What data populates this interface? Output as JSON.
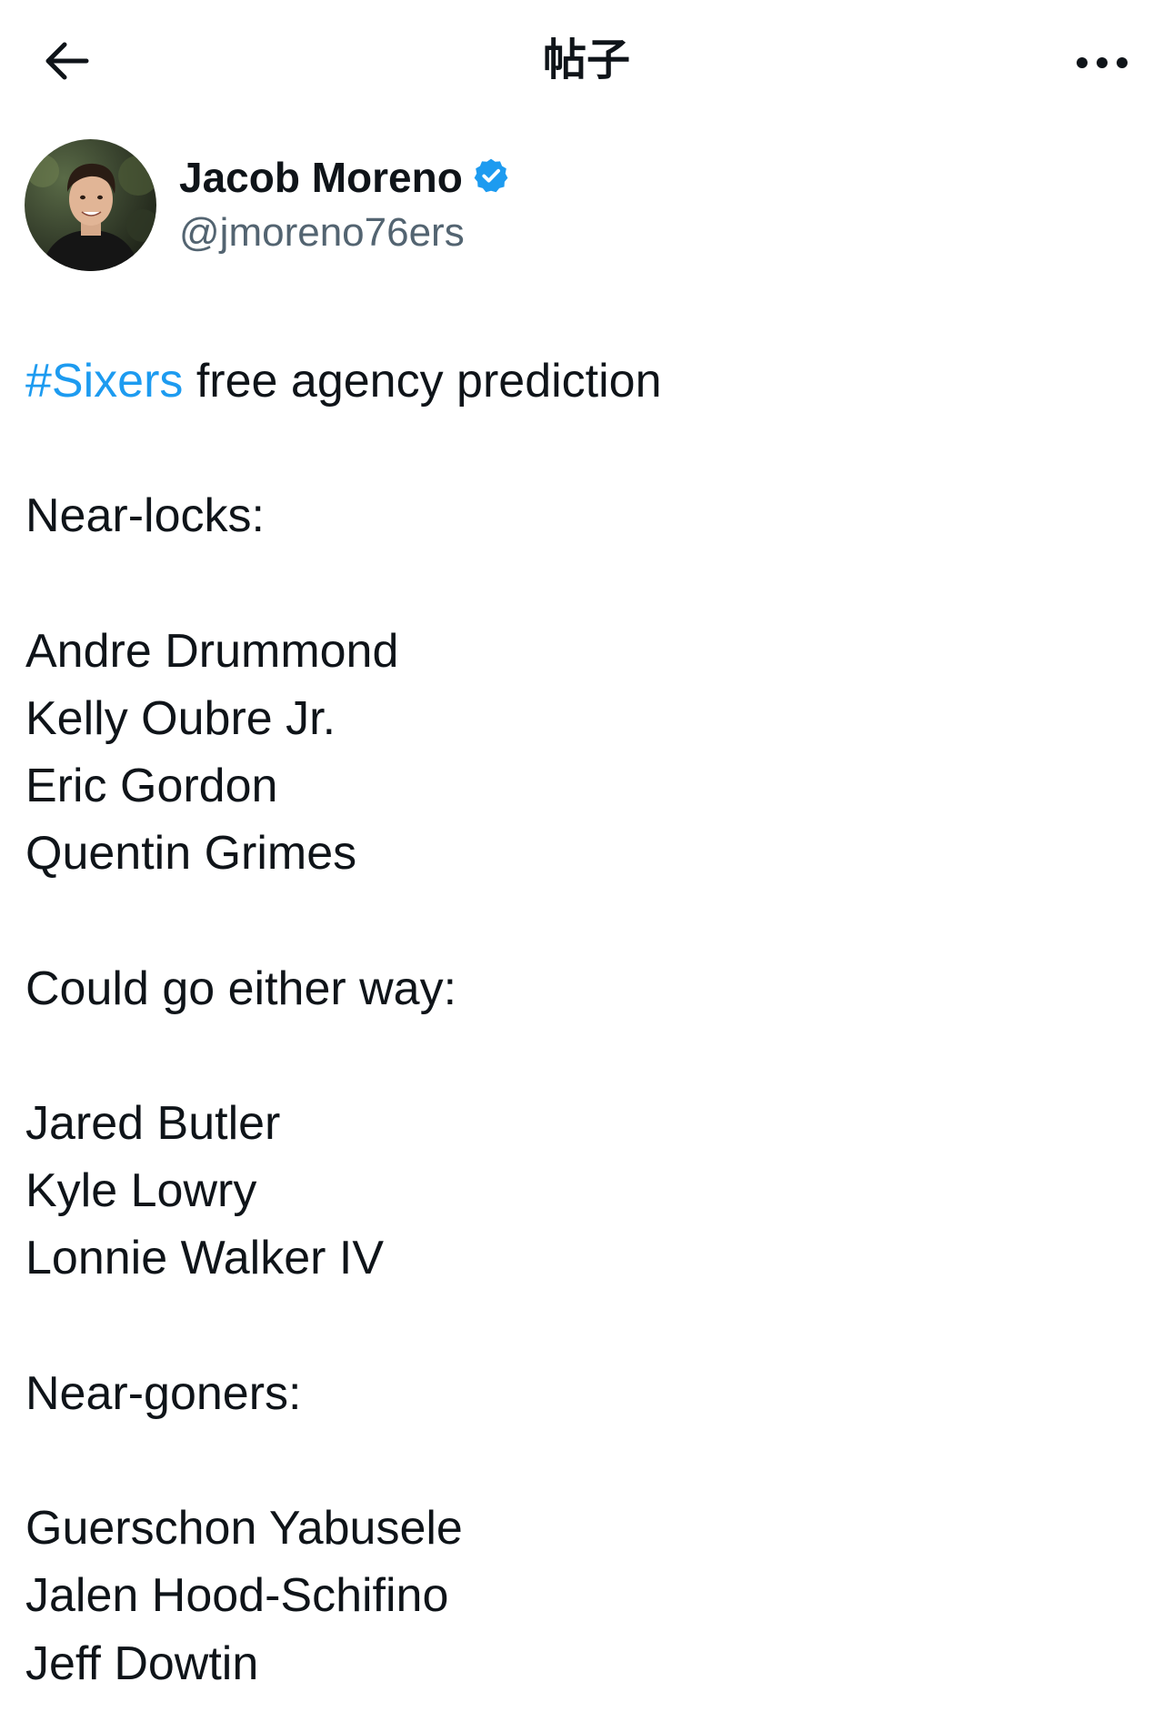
{
  "header": {
    "title": "帖子",
    "back_icon": "back-arrow-icon",
    "more_icon": "more-horizontal-icon"
  },
  "author": {
    "display_name": "Jacob Moreno",
    "handle": "@jmoreno76ers",
    "verified": true,
    "verified_color": "#1d9bf0"
  },
  "tweet": {
    "hashtag": "#Sixers",
    "headline_rest": " free agency prediction",
    "section1_title": "Near-locks:",
    "section1_players": [
      "Andre Drummond",
      "Kelly Oubre Jr.",
      "Eric Gordon",
      "Quentin Grimes"
    ],
    "section2_title": "Could go either way:",
    "section2_players": [
      "Jared Butler",
      "Kyle Lowry",
      "Lonnie Walker IV"
    ],
    "section3_title": "Near-goners:",
    "section3_players": [
      "Guerschon Yabusele",
      "Jalen Hood-Schifino",
      "Jeff Dowtin"
    ]
  },
  "colors": {
    "text": "#0f1419",
    "secondary": "#536471",
    "accent": "#1d9bf0",
    "background": "#ffffff"
  }
}
